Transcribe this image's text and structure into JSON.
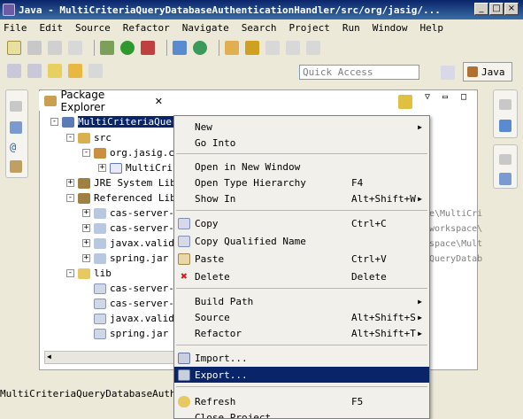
{
  "window": {
    "title": "Java - MultiCriteriaQueryDatabaseAuthenticationHandler/src/org/jasig/..."
  },
  "menubar": [
    "File",
    "Edit",
    "Source",
    "Refactor",
    "Navigate",
    "Search",
    "Project",
    "Run",
    "Window",
    "Help"
  ],
  "toolbar": {
    "quick_access_placeholder": "Quick Access",
    "perspective_label": "Java"
  },
  "explorer": {
    "tab_label": "Package Explorer",
    "tree": [
      {
        "label": "MultiCriteriaQuery",
        "level": 0,
        "toggle": "-"
      },
      {
        "label": "src",
        "level": 1,
        "toggle": "-"
      },
      {
        "label": "org.jasig.c",
        "level": 2,
        "toggle": "-"
      },
      {
        "label": "MultiCri",
        "level": 3,
        "toggle": "+"
      },
      {
        "label": "JRE System Lib",
        "level": 1,
        "toggle": "+"
      },
      {
        "label": "Referenced Lib",
        "level": 1,
        "toggle": "-"
      },
      {
        "label": "cas-server-",
        "level": 2,
        "toggle": "+"
      },
      {
        "label": "cas-server-",
        "level": 2,
        "toggle": "+"
      },
      {
        "label": "javax.valid",
        "level": 2,
        "toggle": "+"
      },
      {
        "label": "spring.jar",
        "level": 2,
        "toggle": "+"
      },
      {
        "label": "lib",
        "level": 1,
        "toggle": "-"
      },
      {
        "label": "cas-server-",
        "level": 2,
        "toggle": ""
      },
      {
        "label": "cas-server-",
        "level": 2,
        "toggle": ""
      },
      {
        "label": "javax.valid",
        "level": 2,
        "toggle": ""
      },
      {
        "label": "spring.jar",
        "level": 2,
        "toggle": ""
      }
    ],
    "trailing_paths": [
      "e\\MultiCri",
      "workspace\\",
      "space\\Mult",
      "QueryDatab"
    ]
  },
  "status": {
    "text": "MultiCriteriaQueryDatabaseAuther"
  },
  "context_menu": {
    "items": [
      {
        "label": "New",
        "accel": "",
        "submenu": true,
        "icon": ""
      },
      {
        "label": "Go Into",
        "accel": "",
        "submenu": false,
        "icon": ""
      },
      {
        "sep": true
      },
      {
        "label": "Open in New Window",
        "accel": "",
        "submenu": false,
        "icon": ""
      },
      {
        "label": "Open Type Hierarchy",
        "accel": "F4",
        "submenu": false,
        "icon": ""
      },
      {
        "label": "Show In",
        "accel": "Alt+Shift+W",
        "submenu": true,
        "icon": ""
      },
      {
        "sep": true
      },
      {
        "label": "Copy",
        "accel": "Ctrl+C",
        "submenu": false,
        "icon": "copy-icon"
      },
      {
        "label": "Copy Qualified Name",
        "accel": "",
        "submenu": false,
        "icon": "copy-qualified-icon"
      },
      {
        "label": "Paste",
        "accel": "Ctrl+V",
        "submenu": false,
        "icon": "paste-icon"
      },
      {
        "label": "Delete",
        "accel": "Delete",
        "submenu": false,
        "icon": "delete-icon"
      },
      {
        "sep": true
      },
      {
        "label": "Build Path",
        "accel": "",
        "submenu": true,
        "icon": ""
      },
      {
        "label": "Source",
        "accel": "Alt+Shift+S",
        "submenu": true,
        "icon": ""
      },
      {
        "label": "Refactor",
        "accel": "Alt+Shift+T",
        "submenu": true,
        "icon": ""
      },
      {
        "sep": true
      },
      {
        "label": "Import...",
        "accel": "",
        "submenu": false,
        "icon": "import-icon"
      },
      {
        "label": "Export...",
        "accel": "",
        "submenu": false,
        "icon": "export-icon",
        "highlight": true
      },
      {
        "sep": true
      },
      {
        "label": "Refresh",
        "accel": "F5",
        "submenu": false,
        "icon": "refresh-icon"
      },
      {
        "label": "Close Project",
        "accel": "",
        "submenu": false,
        "icon": ""
      }
    ]
  },
  "colors": {
    "selection": "#0a246a",
    "menu_bg": "#f1f0ea",
    "window_bg": "#ece9d8"
  }
}
